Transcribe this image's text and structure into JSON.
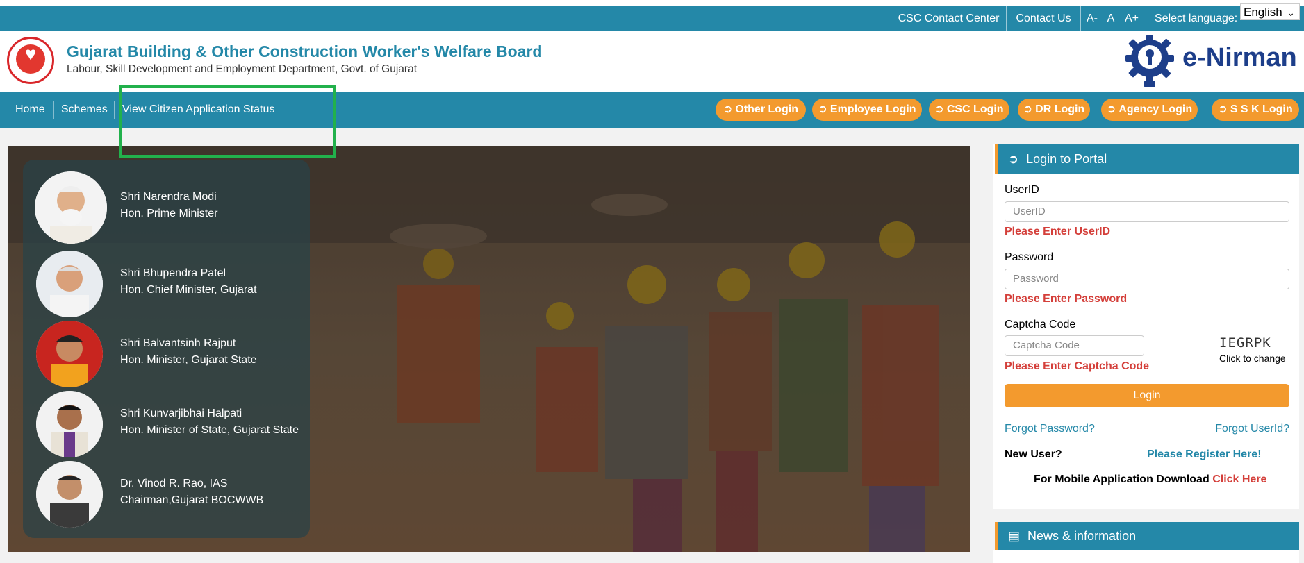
{
  "topbar": {
    "csc_contact": "CSC Contact Center",
    "contact_us": "Contact Us",
    "font_small": "A-",
    "font_normal": "A",
    "font_large": "A+",
    "select_language_label": "Select language:",
    "language_value": "English"
  },
  "header": {
    "title": "Gujarat Building & Other Construction Worker's Welfare Board",
    "subtitle": "Labour, Skill Development and Employment Department, Govt. of Gujarat",
    "brand": "e-Nirman"
  },
  "nav": {
    "home": "Home",
    "schemes": "Schemes",
    "view_status": "View Citizen Application Status",
    "logins": [
      "Other Login",
      "Employee Login",
      "CSC Login",
      "DR Login",
      "Agency Login",
      "S S K Login"
    ]
  },
  "leaders": [
    {
      "name": "Shri Narendra Modi",
      "role": "Hon. Prime Minister"
    },
    {
      "name": "Shri Bhupendra Patel",
      "role": "Hon. Chief Minister, Gujarat"
    },
    {
      "name": "Shri Balvantsinh Rajput",
      "role": "Hon. Minister, Gujarat State"
    },
    {
      "name": "Shri Kunvarjibhai Halpati",
      "role": "Hon. Minister of State, Gujarat State"
    },
    {
      "name": "Dr. Vinod R. Rao, IAS",
      "role": "Chairman,Gujarat BOCWWB"
    }
  ],
  "login": {
    "title": "Login to Portal",
    "userid_label": "UserID",
    "userid_placeholder": "UserID",
    "userid_error": "Please Enter UserID",
    "password_label": "Password",
    "password_placeholder": "Password",
    "password_error": "Please Enter Password",
    "captcha_label": "Captcha Code",
    "captcha_placeholder": "Captcha Code",
    "captcha_error": "Please Enter Captcha Code",
    "captcha_text": "IEGRPK",
    "captcha_note": "Click to change",
    "login_button": "Login",
    "forgot_password": "Forgot Password?",
    "forgot_userid": "Forgot UserId?",
    "new_user": "New User?",
    "register": "Please Register Here!",
    "mobile_text": "For Mobile Application Download",
    "mobile_link": "Click Here"
  },
  "news": {
    "title": "News & information"
  },
  "colors": {
    "primary": "#2488a8",
    "accent": "#f39a2e",
    "error": "#d43f3a",
    "highlight": "#22b14c"
  }
}
